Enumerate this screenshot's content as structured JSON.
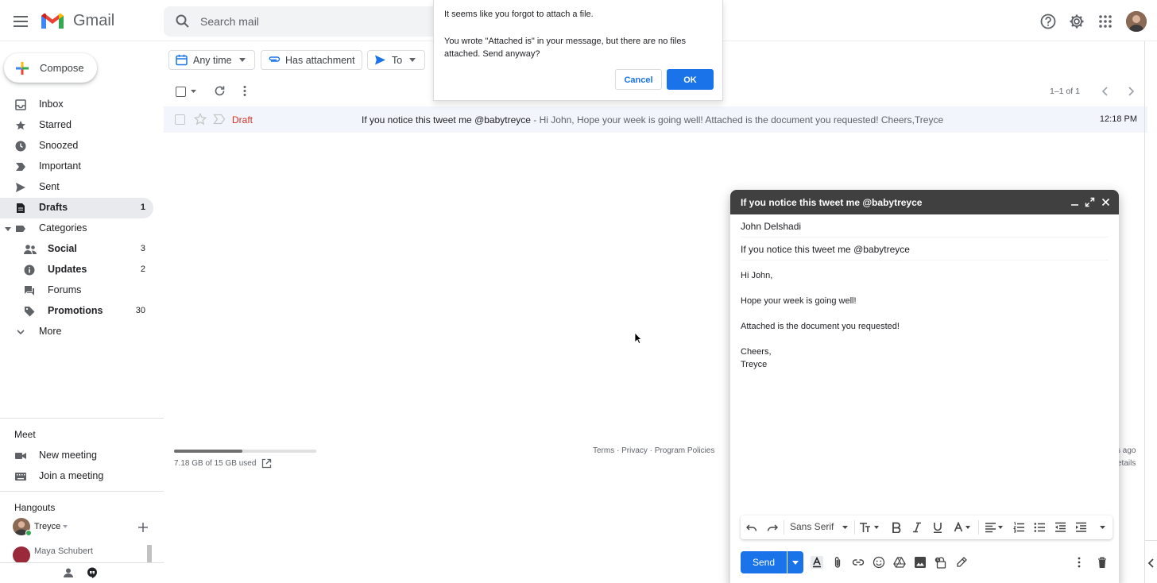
{
  "header": {
    "app_name": "Gmail",
    "search_placeholder": "Search mail"
  },
  "compose_label": "Compose",
  "nav": {
    "inbox": "Inbox",
    "starred": "Starred",
    "snoozed": "Snoozed",
    "important": "Important",
    "sent": "Sent",
    "drafts": "Drafts",
    "drafts_count": "1",
    "categories": "Categories",
    "social": "Social",
    "social_count": "3",
    "updates": "Updates",
    "updates_count": "2",
    "forums": "Forums",
    "promotions": "Promotions",
    "promotions_count": "30",
    "more": "More"
  },
  "meet": {
    "heading": "Meet",
    "new_meeting": "New meeting",
    "join_meeting": "Join a meeting"
  },
  "hangouts": {
    "heading": "Hangouts",
    "user": "Treyce",
    "contact": "Maya Schubert"
  },
  "filters": {
    "any_time": "Any time",
    "has_attachment": "Has attachment",
    "to": "To"
  },
  "pagination": "1–1 of 1",
  "email_row": {
    "label": "Draft",
    "subject": "If you notice this tweet me @babytreyce",
    "snippet": " - Hi John, Hope your week is going well! Attached is the document you requested! Cheers,Treyce",
    "time": "12:18 PM"
  },
  "footer": {
    "links": "Terms · Privacy · Program Policies",
    "storage": "7.18 GB of 15 GB used",
    "storage_fraction": 0.48,
    "partial_activity": "s ago",
    "partial_details": "etails"
  },
  "dialog": {
    "line1": "It seems like you forgot to attach a file.",
    "line2": "You wrote \"Attached is\" in your message, but there are no files attached. Send anyway?",
    "cancel": "Cancel",
    "ok": "OK"
  },
  "composer": {
    "title": "If you notice this tweet me @babytreyce",
    "recipient": "John Delshadi",
    "subject": "If you notice this tweet me @babytreyce",
    "body_greeting": "Hi John,",
    "body_line1": "Hope your week is going well!",
    "body_line2": "Attached is the document you requested!",
    "body_sign1": "Cheers,",
    "body_sign2": "Treyce",
    "font_name": "Sans Serif",
    "send_label": "Send"
  },
  "colors": {
    "accent": "#1a73e8",
    "draft_red": "#d93025",
    "composer_header": "#404040"
  }
}
